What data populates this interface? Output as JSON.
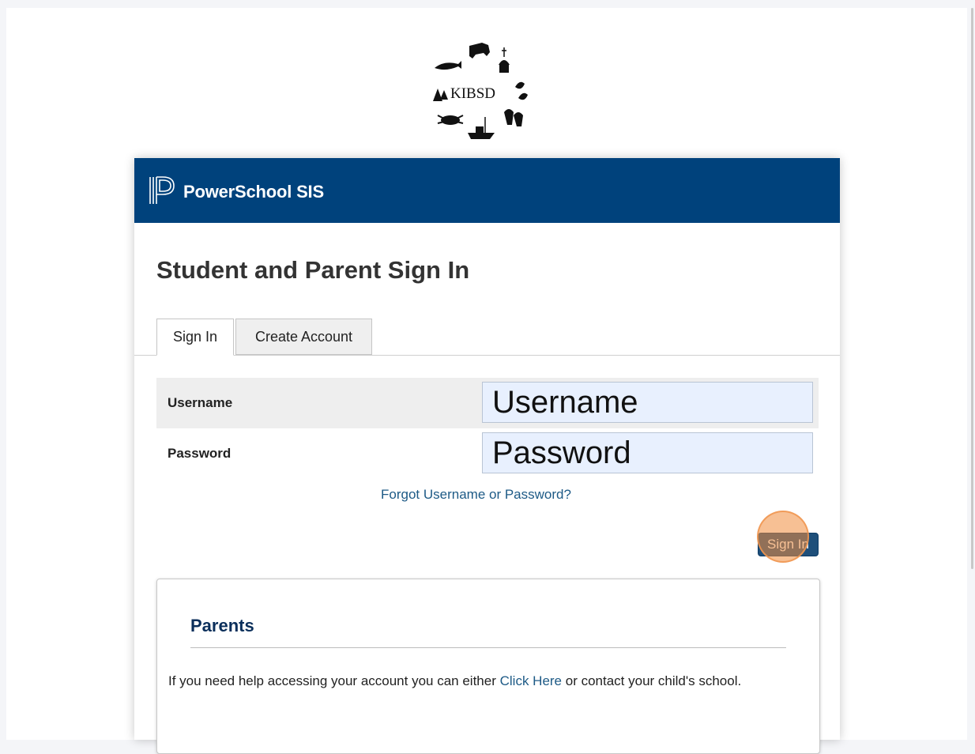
{
  "logo": {
    "text": "KIBSD"
  },
  "header": {
    "brand": "PowerSchool SIS"
  },
  "page_title": "Student and Parent Sign In",
  "tabs": [
    {
      "label": "Sign In",
      "active": true
    },
    {
      "label": "Create Account",
      "active": false
    }
  ],
  "form": {
    "username": {
      "label": "Username",
      "value": "Username"
    },
    "password": {
      "label": "Password",
      "value": "Password"
    },
    "forgot_link": "Forgot Username or Password?",
    "submit_label": "Sign In"
  },
  "parents_panel": {
    "title": "Parents",
    "text_before": "If you need help accessing your account you can either ",
    "link": "Click Here",
    "text_after": " or contact your child's school."
  },
  "colors": {
    "banner": "#00427c",
    "link": "#1d5a86",
    "autofill_field": "#e8f0fe",
    "panel_title": "#0b2f5b"
  }
}
